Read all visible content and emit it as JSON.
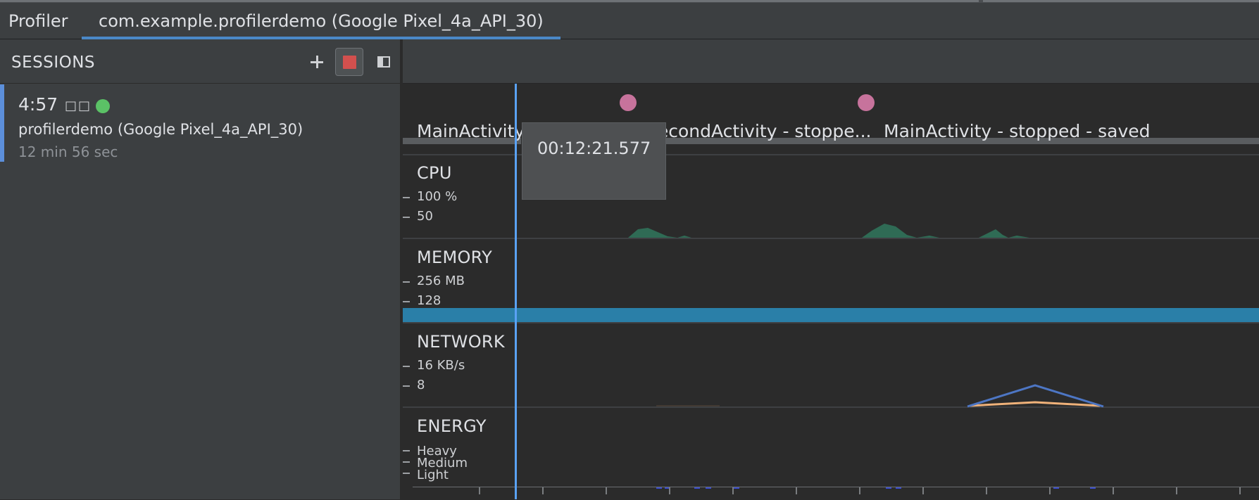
{
  "header": {
    "profiler_tab": "Profiler",
    "session_tab": "com.example.profilerdemo (Google Pixel_4a_API_30)"
  },
  "sidebar": {
    "title": "SESSIONS",
    "session": {
      "time": "4:57",
      "boxes": "□□",
      "name": "profilerdemo (Google Pixel_4a_API_30)",
      "duration": "12 min 56 sec",
      "status_color": "#5bc266"
    }
  },
  "timeline": {
    "activities": [
      {
        "label": "MainActivity"
      },
      {
        "label": "SecondActivity - stoppe..."
      },
      {
        "label": "MainActivity - stopped - saved"
      }
    ],
    "tooltip": "00:12:21.577"
  },
  "tracks": {
    "cpu": {
      "title": "CPU",
      "ticks": [
        "100 %",
        "50"
      ]
    },
    "memory": {
      "title": "MEMORY",
      "ticks": [
        "256 MB",
        "128"
      ]
    },
    "network": {
      "title": "NETWORK",
      "ticks": [
        "16 KB/s",
        "8"
      ]
    },
    "energy": {
      "title": "ENERGY",
      "ticks": [
        "Heavy",
        "Medium",
        "Light"
      ]
    }
  },
  "colors": {
    "accent": "#4a88c7",
    "playhead": "#5aa2f5",
    "stop": "#d2504e",
    "cpu": "#2f6b55",
    "memory": "#2a7fa8",
    "network_rx": "#4d76c4",
    "network_tx": "#f0b27a",
    "event_dot": "#c7739c"
  }
}
